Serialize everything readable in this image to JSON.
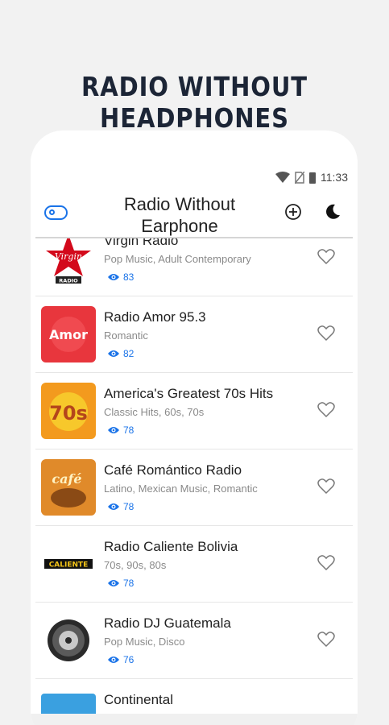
{
  "promo": {
    "headline": "RADIO WITHOUT HEADPHONES"
  },
  "status_bar": {
    "time": "11:33"
  },
  "app_bar": {
    "title_line1": "Radio Without",
    "title_line2": "Earphone"
  },
  "colors": {
    "accent": "#1a73e8",
    "headline": "#1c2536"
  },
  "stations": [
    {
      "name": "Virgin Radio",
      "genres": "Pop Music, Adult Contemporary",
      "views": "83",
      "logo": "virgin-radio-logo"
    },
    {
      "name": "Radio Amor 95.3",
      "genres": "Romantic",
      "views": "82",
      "logo": "radio-amor-logo"
    },
    {
      "name": "America's Greatest 70s Hits",
      "genres": "Classic Hits, 60s, 70s",
      "views": "78",
      "logo": "70s-hits-logo"
    },
    {
      "name": "Café Romántico Radio",
      "genres": "Latino, Mexican Music, Romantic",
      "views": "78",
      "logo": "cafe-romantico-logo"
    },
    {
      "name": "Radio Caliente Bolivia",
      "genres": "70s, 90s, 80s",
      "views": "78",
      "logo": "radio-caliente-logo"
    },
    {
      "name": "Radio DJ Guatemala",
      "genres": "Pop Music, Disco",
      "views": "76",
      "logo": "radio-dj-logo"
    },
    {
      "name": "Continental",
      "genres": "",
      "views": "",
      "logo": "continental-logo"
    }
  ],
  "logo_text": {
    "virgin": "Virgin",
    "virgin_sub": "RADIO",
    "amor": "Amor",
    "seventies": "70s",
    "cafe": "café",
    "caliente": "CALIENTE"
  }
}
